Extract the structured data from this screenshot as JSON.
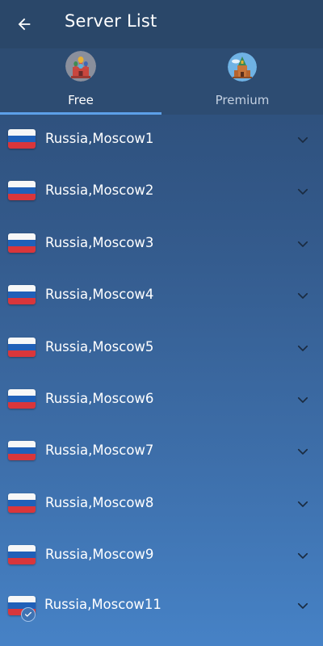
{
  "header": {
    "title": "Server List"
  },
  "tabs": [
    {
      "label": "Free",
      "icon": "saint-basil-cathedral-icon",
      "selected": true
    },
    {
      "label": "Premium",
      "icon": "kremlin-tower-icon",
      "selected": false
    }
  ],
  "servers": [
    {
      "name": "Russia,Moscow1",
      "flag": "russia-flag-icon"
    },
    {
      "name": "Russia,Moscow2",
      "flag": "russia-flag-icon"
    },
    {
      "name": "Russia,Moscow3",
      "flag": "russia-flag-icon"
    },
    {
      "name": "Russia,Moscow4",
      "flag": "russia-flag-icon"
    },
    {
      "name": "Russia,Moscow5",
      "flag": "russia-flag-icon"
    },
    {
      "name": "Russia,Moscow6",
      "flag": "russia-flag-icon"
    },
    {
      "name": "Russia,Moscow7",
      "flag": "russia-flag-icon"
    },
    {
      "name": "Russia,Moscow8",
      "flag": "russia-flag-icon"
    },
    {
      "name": "Russia,Moscow9",
      "flag": "russia-flag-icon"
    },
    {
      "name": "Russia,Moscow11",
      "flag": "russia-flag-icon",
      "selected": true
    }
  ],
  "colors": {
    "header_bg": "#2a4769",
    "tab_indicator": "#5da0e8",
    "flag_white": "#f7f7f7",
    "flag_blue": "#2060b8",
    "flag_red": "#d9363b"
  }
}
